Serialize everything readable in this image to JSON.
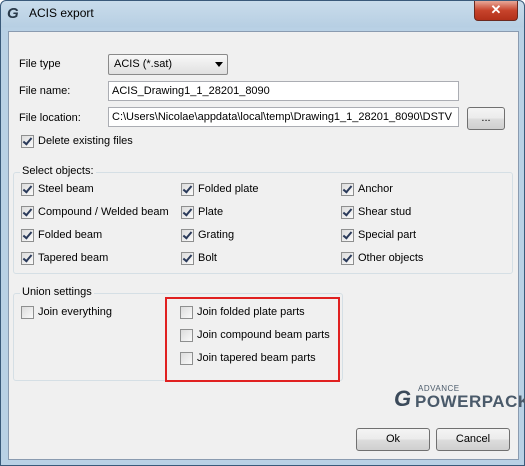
{
  "window": {
    "title": "ACIS export",
    "close_glyph": "✕",
    "app_icon": "G"
  },
  "file": {
    "type_label": "File type",
    "type_value": "ACIS (*.sat)",
    "name_label": "File name:",
    "name_value": "ACIS_Drawing1_1_28201_8090",
    "location_label": "File location:",
    "location_value": "C:\\Users\\Nicolae\\appdata\\local\\temp\\Drawing1_1_28201_8090\\DSTV",
    "browse_label": "...",
    "delete_label": "Delete existing files",
    "delete_checked": true
  },
  "select_objects": {
    "title": "Select objects:",
    "items": [
      {
        "label": "Steel beam",
        "checked": true
      },
      {
        "label": "Compound / Welded beam",
        "checked": true
      },
      {
        "label": "Folded beam",
        "checked": true
      },
      {
        "label": "Tapered beam",
        "checked": true
      },
      {
        "label": "Folded plate",
        "checked": true
      },
      {
        "label": "Plate",
        "checked": true
      },
      {
        "label": "Grating",
        "checked": true
      },
      {
        "label": "Bolt",
        "checked": true
      },
      {
        "label": "Anchor",
        "checked": true
      },
      {
        "label": "Shear stud",
        "checked": true
      },
      {
        "label": "Special part",
        "checked": true
      },
      {
        "label": "Other objects",
        "checked": true
      }
    ]
  },
  "union": {
    "title": "Union settings",
    "items": [
      {
        "label": "Join everything",
        "checked": false
      },
      {
        "label": "Join folded plate parts",
        "checked": false
      },
      {
        "label": "Join compound beam parts",
        "checked": false
      },
      {
        "label": "Join tapered beam parts",
        "checked": false
      }
    ]
  },
  "logo": {
    "small": "ADVANCE",
    "big": "POWERPACK",
    "mark": "G"
  },
  "buttons": {
    "ok": "Ok",
    "cancel": "Cancel"
  },
  "colors": {
    "highlight": "#e02020",
    "title_bar": "#b9d1e5",
    "close_button": "#c7432b"
  }
}
